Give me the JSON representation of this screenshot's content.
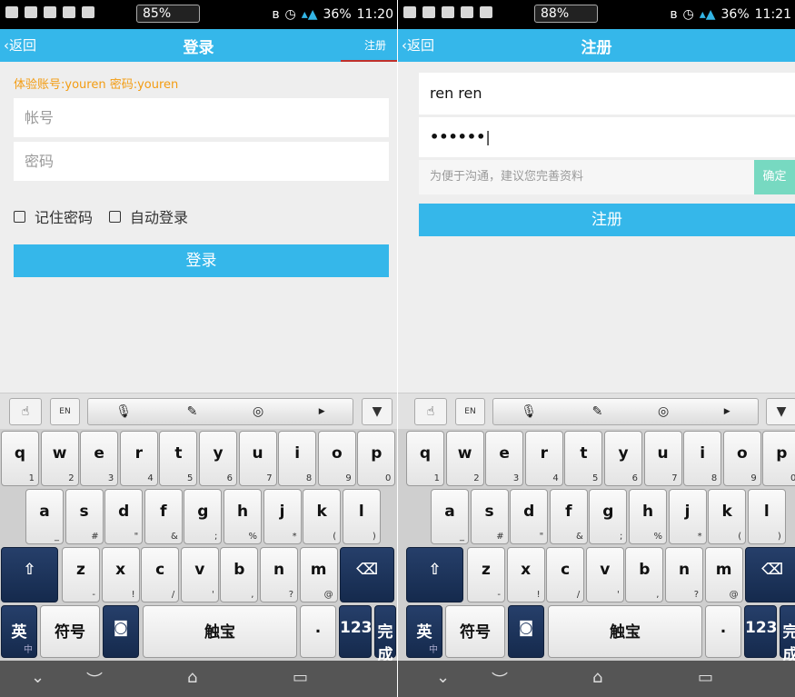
{
  "left": {
    "status": {
      "battery_meter": "85%",
      "battery_pct": "36%",
      "time": "11:20"
    },
    "nav": {
      "back": "返回",
      "title": "登录",
      "right": "注册"
    },
    "hint": "体验账号:youren 密码:youren",
    "account_placeholder": "帐号",
    "password_placeholder": "密码",
    "remember_label": "记住密码",
    "autologin_label": "自动登录",
    "login_button": "登录"
  },
  "right": {
    "status": {
      "battery_meter": "88%",
      "battery_pct": "36%",
      "time": "11:21"
    },
    "nav": {
      "back": "返回",
      "title": "注册"
    },
    "username_value": "ren ren",
    "password_value": "••••••",
    "info_placeholder": "为便于沟通，建议您完善资料",
    "confirm_button": "确定",
    "register_button": "注册"
  },
  "keyboard": {
    "row1": [
      [
        "q",
        "1"
      ],
      [
        "w",
        "2"
      ],
      [
        "e",
        "3"
      ],
      [
        "r",
        "4"
      ],
      [
        "t",
        "5"
      ],
      [
        "y",
        "6"
      ],
      [
        "u",
        "7"
      ],
      [
        "i",
        "8"
      ],
      [
        "o",
        "9"
      ],
      [
        "p",
        "0"
      ]
    ],
    "row2": [
      [
        "a",
        "_"
      ],
      [
        "s",
        "#"
      ],
      [
        "d",
        "\""
      ],
      [
        "f",
        "&"
      ],
      [
        "g",
        ";"
      ],
      [
        "h",
        "%"
      ],
      [
        "j",
        "*"
      ],
      [
        "k",
        "("
      ],
      [
        "l",
        ")"
      ]
    ],
    "row3": [
      [
        "z",
        "-"
      ],
      [
        "x",
        "!"
      ],
      [
        "c",
        "/"
      ],
      [
        "v",
        "'"
      ],
      [
        "b",
        ","
      ],
      [
        "n",
        "?"
      ],
      [
        "m",
        "@"
      ]
    ],
    "lang_key": "英",
    "lang_sub": "中",
    "symbols_key": "符号",
    "space_brand": "触宝",
    "period_key": ".",
    "num_key": "123",
    "done_key": "完成",
    "layout_toggle": "EN"
  }
}
